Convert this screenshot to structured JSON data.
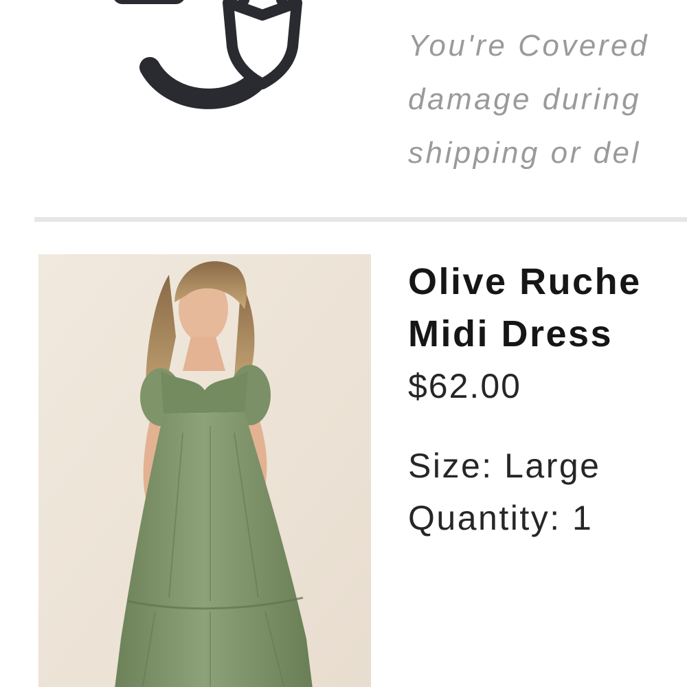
{
  "protection": {
    "icon": "hand-shield-icon",
    "lines": [
      "You're Covered",
      "damage during",
      "shipping or del"
    ]
  },
  "product": {
    "name_lines": [
      "Olive Ruche",
      "Midi Dress"
    ],
    "price": "$62.00",
    "size_label": "Size:",
    "size_value": "Large",
    "quantity_label": "Quantity:",
    "quantity_value": "1",
    "image": "olive-dress-photo"
  },
  "colors": {
    "icon_stroke": "#2a2b30",
    "muted_text": "#9a9a9a",
    "divider": "#e6e6e6",
    "image_bg": "#efe6da",
    "dress": "#7d9266"
  }
}
